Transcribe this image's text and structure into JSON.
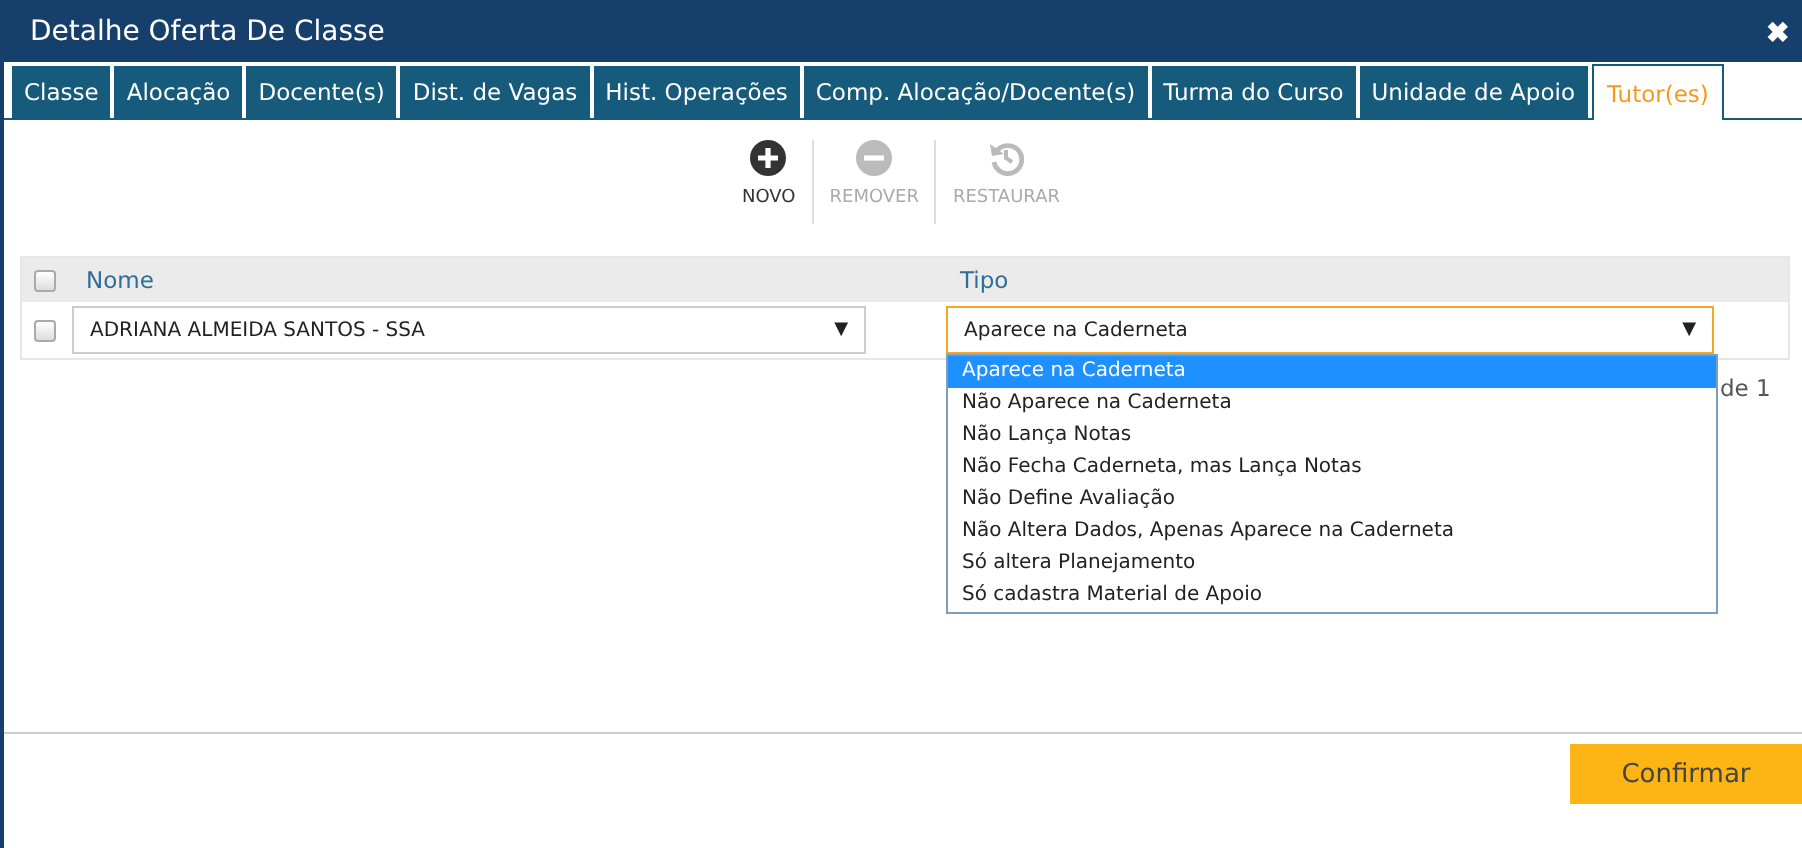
{
  "window": {
    "title": "Detalhe Oferta De Classe",
    "close": "✖"
  },
  "tabs": [
    {
      "label": "Classe",
      "selected": false
    },
    {
      "label": "Alocação",
      "selected": false
    },
    {
      "label": "Docente(s)",
      "selected": false
    },
    {
      "label": "Dist. de Vagas",
      "selected": false
    },
    {
      "label": "Hist. Operações",
      "selected": false
    },
    {
      "label": "Comp. Alocação/Docente(s)",
      "selected": false
    },
    {
      "label": "Turma do Curso",
      "selected": false
    },
    {
      "label": "Unidade de Apoio",
      "selected": false
    },
    {
      "label": "Tutor(es)",
      "selected": true
    }
  ],
  "toolbar": [
    {
      "kind": "add",
      "label": "NOVO",
      "disabled": false
    },
    {
      "kind": "remove",
      "label": "REMOVER",
      "disabled": true
    },
    {
      "kind": "restore",
      "label": "RESTAURAR",
      "disabled": true
    }
  ],
  "table": {
    "header_checked": false,
    "columns": [
      "Nome",
      "Tipo"
    ],
    "rows": [
      {
        "checked": false,
        "nome": "ADRIANA ALMEIDA SANTOS - SSA",
        "tipo": "Aparece na Caderneta",
        "caret": "▼"
      }
    ]
  },
  "pager": "de 1",
  "tipo_options": [
    {
      "label": "Aparece na Caderneta",
      "selected": true
    },
    {
      "label": "Não Aparece na Caderneta",
      "selected": false
    },
    {
      "label": "Não Lança Notas",
      "selected": false
    },
    {
      "label": "Não Fecha Caderneta, mas Lança Notas",
      "selected": false
    },
    {
      "label": "Não Define Avaliação",
      "selected": false
    },
    {
      "label": "Não Altera Dados, Apenas Aparece na Caderneta",
      "selected": false
    },
    {
      "label": "Só altera Planejamento",
      "selected": false
    },
    {
      "label": "Só cadastra Material de Apoio",
      "selected": false
    }
  ],
  "confirm": "Confirmar"
}
